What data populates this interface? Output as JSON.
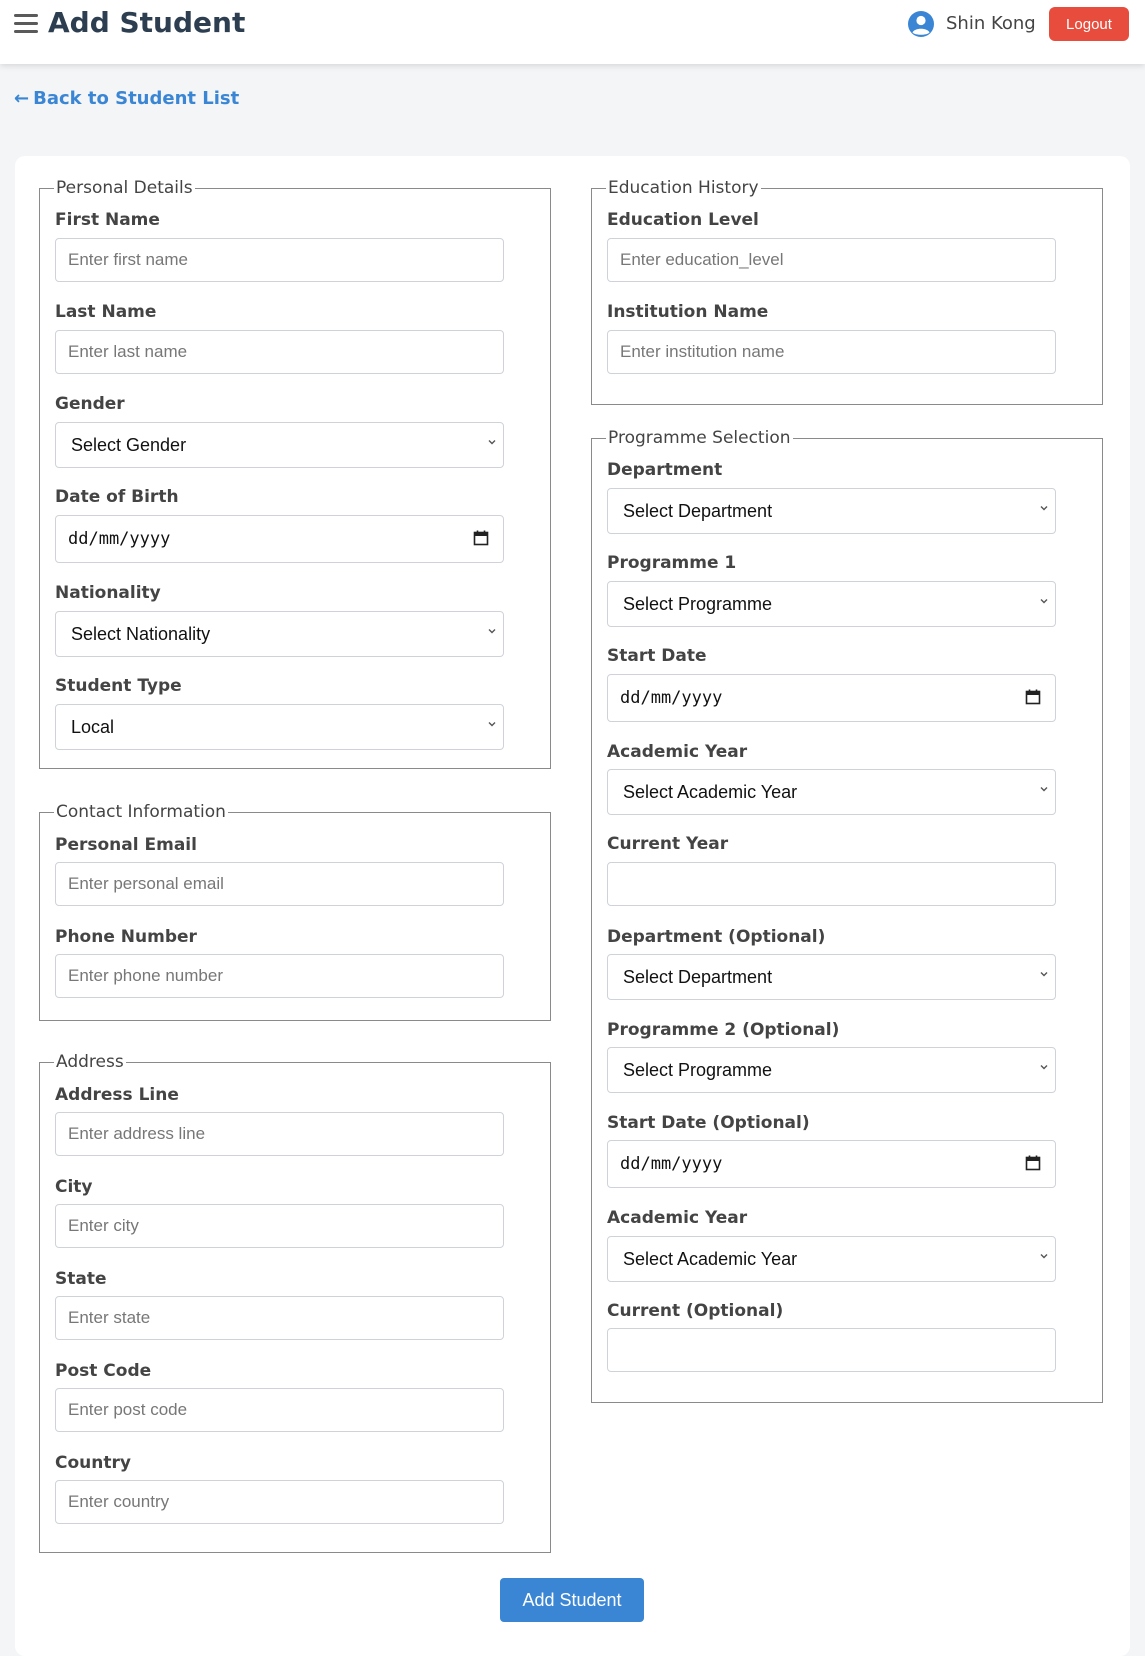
{
  "header": {
    "title": "Add Student",
    "user_name": "Shin Kong",
    "logout_label": "Logout"
  },
  "back_link": "Back to Student List",
  "personal": {
    "legend": "Personal Details",
    "first_name_label": "First Name",
    "first_name_placeholder": "Enter first name",
    "last_name_label": "Last Name",
    "last_name_placeholder": "Enter last name",
    "gender_label": "Gender",
    "gender_value": "Select Gender",
    "dob_label": "Date of Birth",
    "dob_value": "dd/mm/yyyy",
    "nationality_label": "Nationality",
    "nationality_value": "Select Nationality",
    "student_type_label": "Student Type",
    "student_type_value": "Local"
  },
  "contact": {
    "legend": "Contact Information",
    "email_label": "Personal Email",
    "email_placeholder": "Enter personal email",
    "phone_label": "Phone Number",
    "phone_placeholder": "Enter phone number"
  },
  "address": {
    "legend": "Address",
    "line_label": "Address Line",
    "line_placeholder": "Enter address line",
    "city_label": "City",
    "city_placeholder": "Enter city",
    "state_label": "State",
    "state_placeholder": "Enter state",
    "postcode_label": "Post Code",
    "postcode_placeholder": "Enter post code",
    "country_label": "Country",
    "country_placeholder": "Enter country"
  },
  "education": {
    "legend": "Education History",
    "level_label": "Education Level",
    "level_placeholder": "Enter education_level",
    "institution_label": "Institution Name",
    "institution_placeholder": "Enter institution name"
  },
  "programme": {
    "legend": "Programme Selection",
    "department_label": "Department",
    "department_value": "Select Department",
    "programme1_label": "Programme 1",
    "programme1_value": "Select Programme",
    "start_date_label": "Start Date",
    "start_date_value": "dd/mm/yyyy",
    "academic_year_label": "Academic Year",
    "academic_year_value": "Select Academic Year",
    "current_year_label": "Current Year",
    "current_year_value": "",
    "department_opt_label": "Department (Optional)",
    "department_opt_value": "Select Department",
    "programme2_label": "Programme 2 (Optional)",
    "programme2_value": "Select Programme",
    "start_date_opt_label": "Start Date (Optional)",
    "start_date_opt_value": "dd/mm/yyyy",
    "academic_year2_label": "Academic Year",
    "academic_year2_value": "Select Academic Year",
    "current_opt_label": "Current (Optional)",
    "current_opt_value": ""
  },
  "submit_label": "Add Student",
  "colors": {
    "primary": "#3a86d4",
    "logout": "#e74c3c",
    "title": "#2c3e50"
  }
}
